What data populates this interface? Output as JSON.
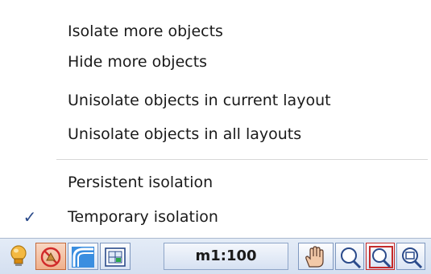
{
  "menu": {
    "items": [
      {
        "label": "Isolate more objects",
        "checked": false
      },
      {
        "label": "Hide more objects",
        "checked": false
      },
      {
        "label": "Unisolate objects in current layout",
        "checked": false
      },
      {
        "label": "Unisolate objects in all layouts",
        "checked": false
      },
      {
        "label": "Persistent isolation",
        "checked": false
      },
      {
        "label": "Temporary isolation",
        "checked": true
      }
    ],
    "check_glyph": "✓"
  },
  "statusbar": {
    "scale": "m1:100",
    "icons": [
      "lightbulb-icon",
      "isolate-objects-icon",
      "curve-icon",
      "layout-grid-icon",
      "pan-hand-icon",
      "zoom-icon",
      "zoom-window-icon",
      "zoom-extents-icon"
    ],
    "accent_color": "#2a4a8a"
  }
}
